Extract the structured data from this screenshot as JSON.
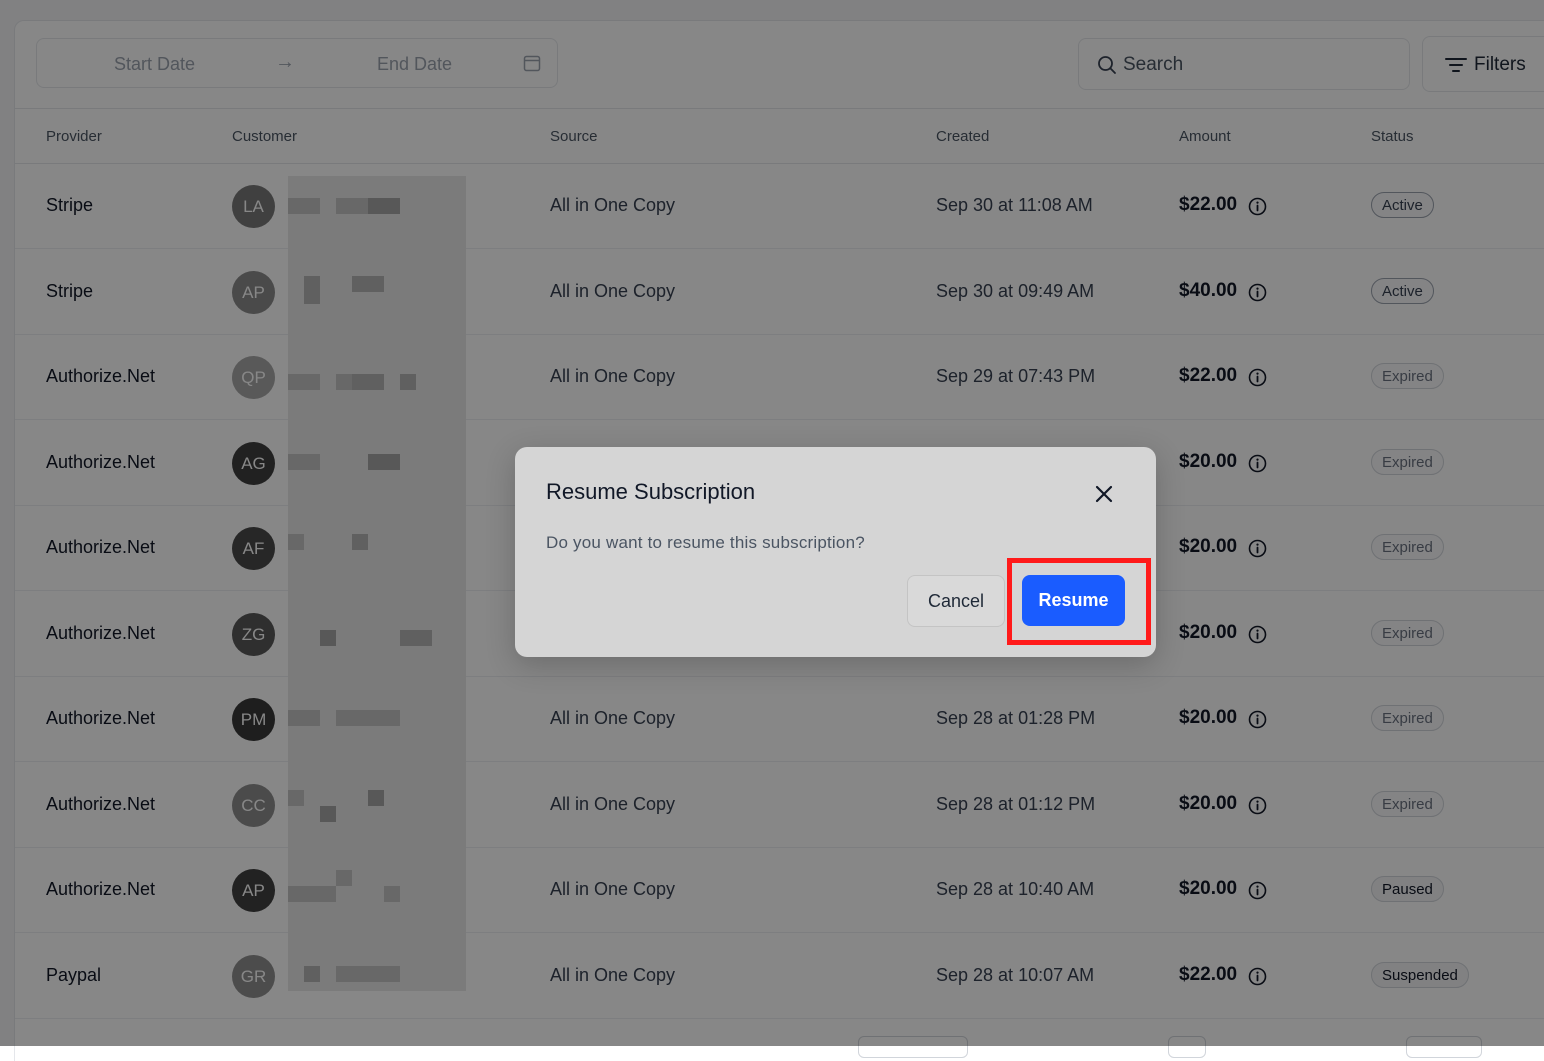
{
  "toolbar": {
    "start_date_placeholder": "Start Date",
    "end_date_placeholder": "End Date",
    "arrow": "→",
    "search_placeholder": "Search",
    "filters_label": "Filters"
  },
  "table": {
    "headers": [
      "Provider",
      "Customer",
      "Source",
      "Created",
      "Amount",
      "Status"
    ],
    "rows": [
      {
        "provider": "Stripe",
        "initials": "LA",
        "source": "All in One Copy",
        "created": "Sep 30 at 11:08 AM",
        "amount": "$22.00",
        "status": "Active"
      },
      {
        "provider": "Stripe",
        "initials": "AP",
        "source": "All in One Copy",
        "created": "Sep 30 at 09:49 AM",
        "amount": "$40.00",
        "status": "Active"
      },
      {
        "provider": "Authorize.Net",
        "initials": "QP",
        "source": "All in One Copy",
        "created": "Sep 29 at 07:43 PM",
        "amount": "$22.00",
        "status": "Expired"
      },
      {
        "provider": "Authorize.Net",
        "initials": "AG",
        "source": "",
        "created": "",
        "amount": "$20.00",
        "status": "Expired"
      },
      {
        "provider": "Authorize.Net",
        "initials": "AF",
        "source": "",
        "created": "",
        "amount": "$20.00",
        "status": "Expired"
      },
      {
        "provider": "Authorize.Net",
        "initials": "ZG",
        "source": "",
        "created": "",
        "amount": "$20.00",
        "status": "Expired"
      },
      {
        "provider": "Authorize.Net",
        "initials": "PM",
        "source": "All in One Copy",
        "created": "Sep 28 at 01:28 PM",
        "amount": "$20.00",
        "status": "Expired"
      },
      {
        "provider": "Authorize.Net",
        "initials": "CC",
        "source": "All in One Copy",
        "created": "Sep 28 at 01:12 PM",
        "amount": "$20.00",
        "status": "Expired"
      },
      {
        "provider": "Authorize.Net",
        "initials": "AP",
        "source": "All in One Copy",
        "created": "Sep 28 at 10:40 AM",
        "amount": "$20.00",
        "status": "Paused"
      },
      {
        "provider": "Paypal",
        "initials": "GR",
        "source": "All in One Copy",
        "created": "Sep 28 at 10:07 AM",
        "amount": "$22.00",
        "status": "Suspended"
      }
    ]
  },
  "avatar_colors": [
    "#7a7a7a",
    "#8c8c8c",
    "#a8a8a8",
    "#3f3f3f",
    "#4a4a4a",
    "#5a5a5a",
    "#3a3a3a",
    "#8e8e8e",
    "#404040",
    "#909090"
  ],
  "modal": {
    "title": "Resume Subscription",
    "message": "Do you want to resume this subscription?",
    "cancel_label": "Cancel",
    "resume_label": "Resume"
  },
  "colors": {
    "primary": "#1a5cff",
    "highlight": "#ff1a1a"
  }
}
